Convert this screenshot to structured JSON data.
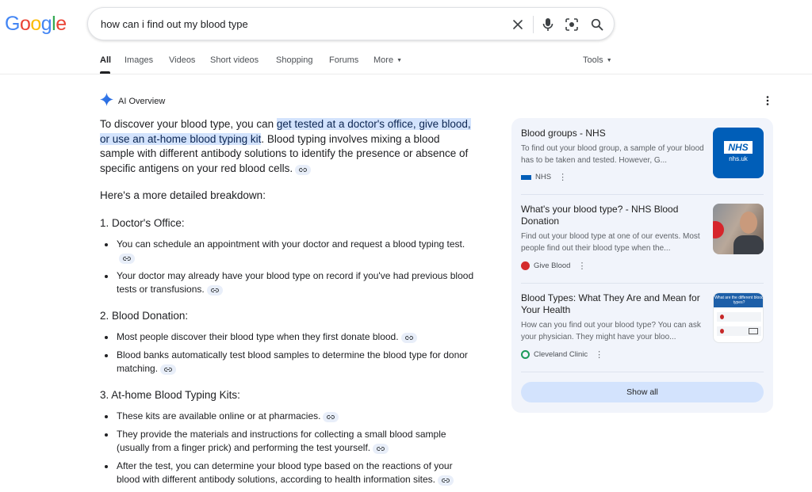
{
  "logo": {
    "letters": [
      "G",
      "o",
      "o",
      "g",
      "l",
      "e"
    ],
    "colors": [
      "#4285f4",
      "#ea4335",
      "#fbbc05",
      "#4285f4",
      "#34a853",
      "#ea4335"
    ]
  },
  "search": {
    "query": "how can i find out my blood type"
  },
  "tabs": {
    "items": [
      {
        "label": "All"
      },
      {
        "label": "Images"
      },
      {
        "label": "Videos"
      },
      {
        "label": "Short videos"
      },
      {
        "label": "Shopping"
      },
      {
        "label": "Forums"
      },
      {
        "label": "More"
      }
    ],
    "tools": "Tools"
  },
  "ai_overview": {
    "label": "AI Overview",
    "intro": {
      "before": "To discover your blood type, you can ",
      "highlight": "get tested at a doctor's office, give blood, or use an at-home blood typing kit",
      "after": ". Blood typing involves mixing a blood sample with different antibody solutions to identify the presence or absence of specific antigens on your red blood cells."
    },
    "breakdown": "Here's a more detailed breakdown:",
    "sections": [
      {
        "number": "1.",
        "title": "Doctor's Office:",
        "bullets": [
          "You can schedule an appointment with your doctor and request a blood typing test.",
          "Your doctor may already have your blood type on record if you've had previous blood tests or transfusions."
        ]
      },
      {
        "number": "2.",
        "title": "Blood Donation:",
        "bullets": [
          "Most people discover their blood type when they first donate blood.",
          "Blood banks automatically test blood samples to determine the blood type for donor matching."
        ]
      },
      {
        "number": "3.",
        "title": "At-home Blood Typing Kits:",
        "bullets": [
          "These kits are available online or at pharmacies.",
          "They provide the materials and instructions for collecting a small blood sample (usually from a finger prick) and performing the test yourself.",
          "After the test, you can determine your blood type based on the reactions of your blood with different antibody solutions, according to health information sites."
        ]
      }
    ]
  },
  "sources": {
    "cards": [
      {
        "title": "Blood groups - NHS",
        "snippet": "To find out your blood group, a sample of your blood has to be taken and tested. However, G...",
        "source": "NHS",
        "thumb_text": "NHS",
        "thumb_sub": "nhs.uk"
      },
      {
        "title": "What's your blood type? - NHS Blood Donation",
        "snippet": "Find out your blood type at one of our events. Most people find out their blood type when the...",
        "source": "Give Blood"
      },
      {
        "title": "Blood Types: What They Are and Mean for Your Health",
        "snippet": "How can you find out your blood type? You can ask your physician. They might have your bloo...",
        "source": "Cleveland Clinic",
        "thumb_text": "What are the different blood types?"
      }
    ],
    "show_all": "Show all"
  },
  "colors": {
    "accent_blue": "#1a73e8",
    "highlight": "#d3e3fd",
    "panel": "#f1f4fb",
    "nhs_blue": "#005eb8"
  }
}
